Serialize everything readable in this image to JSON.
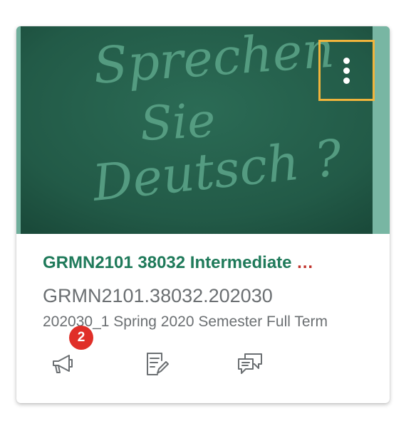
{
  "card": {
    "image_text": [
      "Sprechen",
      "Sie",
      "Deutsch ?"
    ],
    "title": "GRMN2101 38032 Intermediate",
    "title_ellipsis": "…",
    "course_code": "GRMN2101.38032.202030",
    "term": "202030_1 Spring 2020 Semester Full Term",
    "announcements_badge": "2",
    "options_label": "Course options",
    "colors": {
      "title": "#1f7a5a",
      "chalkboard": "#245e4a",
      "options_highlight": "#f0b43c",
      "badge": "#e02f28"
    }
  },
  "actions": [
    {
      "icon": "megaphone-icon",
      "label": "Announcements"
    },
    {
      "icon": "assignment-icon",
      "label": "Assignments"
    },
    {
      "icon": "discussion-icon",
      "label": "Discussions"
    }
  ]
}
